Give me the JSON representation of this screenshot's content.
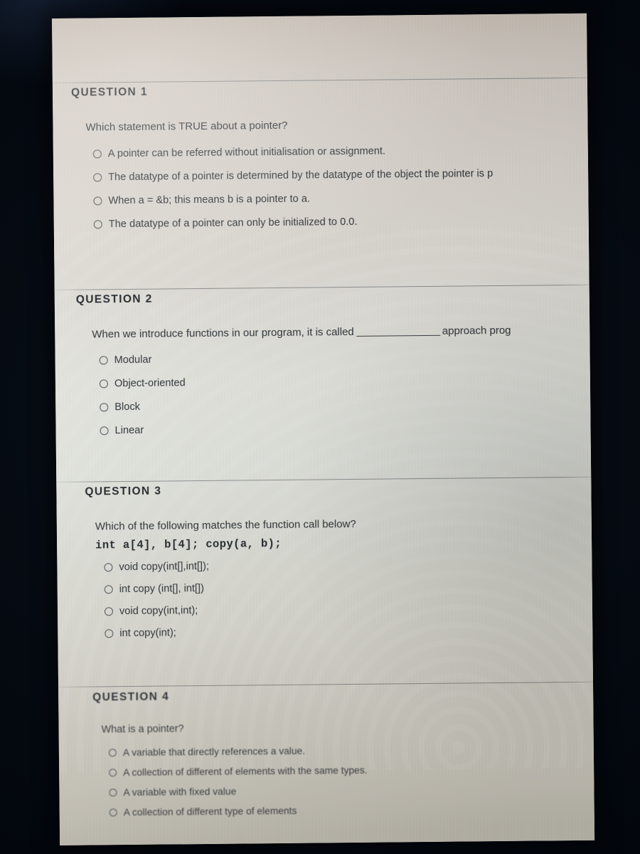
{
  "document": {
    "kind": "online-quiz-page",
    "questions": [
      {
        "header": "QUESTION 1",
        "prompt": "Which statement is TRUE about a pointer?",
        "options": [
          "A pointer can be referred without initialisation or assignment.",
          "The datatype of a pointer is determined by the datatype of the object the pointer is p",
          "When a = &b; this means b is a pointer to a.",
          "The datatype of a pointer can only be initialized to 0.0."
        ]
      },
      {
        "header": "QUESTION 2",
        "prompt_before_blank": "When we introduce functions in our program, it is called",
        "prompt_after_blank": "approach prog",
        "options": [
          "Modular",
          "Object-oriented",
          "Block",
          "Linear"
        ]
      },
      {
        "header": "QUESTION 3",
        "prompt": "Which of the following matches the function call below?",
        "code": "int a[4], b[4]; copy(a, b);",
        "options": [
          "void copy(int[],int[]);",
          "int copy (int[], int[])",
          "void copy(int,int);",
          "int copy(int);"
        ]
      },
      {
        "header": "QUESTION 4",
        "prompt": "What is a pointer?",
        "options": [
          "A variable that directly references a value.",
          "A collection of different of elements with the same types.",
          "A variable with fixed value",
          "A collection of different type of elements"
        ]
      }
    ]
  },
  "colors": {
    "bezel": "#050a11",
    "page_top": "#c6bdb2",
    "page_mid": "#e4e6df",
    "page_bottom": "#bdb9ae",
    "text": "#2c3136",
    "heading": "#21262b",
    "divider": "#5a5f62",
    "radio_outline": "#4e5459"
  }
}
